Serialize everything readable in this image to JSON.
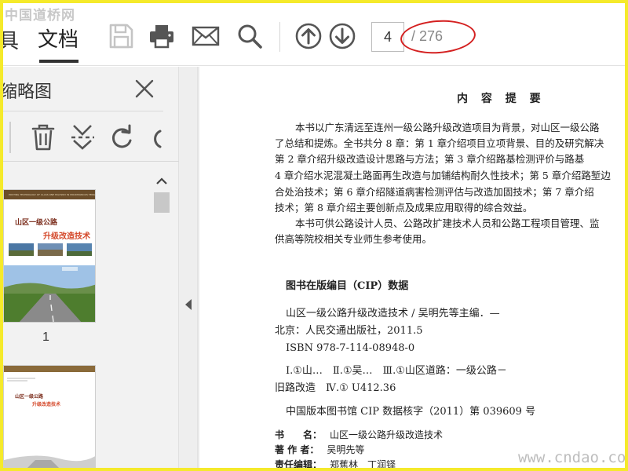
{
  "watermark": {
    "top": "中国道桥网",
    "bottom": "www.cndao.com"
  },
  "toolbar": {
    "menu_partial": "具",
    "menu_document": "文档",
    "icons": [
      "save-icon",
      "print-icon",
      "mail-icon",
      "search-icon",
      "page-up-icon",
      "page-down-icon"
    ],
    "current_page": "4",
    "total_pages": "/ 276"
  },
  "sidebar": {
    "title": "缩略图",
    "tools": [
      "delete-icon",
      "cut-icon",
      "rotate-icon",
      "rotate-partial-icon"
    ],
    "thumbnails": [
      {
        "label": "1",
        "header": "POSTING TECHNOLOGY OF CLASS ONE HIGHWAY IN MOUNTAINOUS TERRAIN",
        "title_line1": "山区一级公路",
        "title_line2": "升级改造技术"
      },
      {
        "label": "",
        "header": "",
        "title_line1": "山区一级公路",
        "title_line2": "升级改造技术"
      }
    ]
  },
  "document": {
    "heading": "内 容 提 要",
    "paragraphs": [
      "本书以广东清远至连州一级公路升级改造项目为背景，对山区一级公路",
      "了总结和提炼。全书共分 8 章：第 1 章介绍项目立项背景、目的及研究解决",
      "第 2 章介绍升级改造设计思路与方法；第 3 章介绍路基检测评价与路基",
      "4 章介绍水泥混凝土路面再生改造与加铺结构耐久性技术；第 5 章介绍路堑边",
      "合处治技术；第 6 章介绍隧道病害检测评估与改造加固技术；第 7 章介绍",
      "技术；第 8 章介绍主要创新点及成果应用取得的综合效益。",
      "本书可供公路设计人员、公路改扩建技术人员和公路工程项目管理、监",
      "供高等院校相关专业师生参考使用。"
    ],
    "cip_title": "图书在版编目（CIP）数据",
    "cip_lines": [
      "山区一级公路升级改造技术 / 吴明先等主编．—",
      "北京：人民交通出版社，2011.5",
      "ISBN 978-7-114-08948-0",
      "Ⅰ.①山…　Ⅱ.①吴…　Ⅲ.①山区道路：一级公路－",
      "旧路改造　Ⅳ.① U412.36",
      "中国版本图书馆 CIP 数据核字（2011）第 039609 号"
    ],
    "meta": [
      {
        "key": "书　　名：",
        "value": "山区一级公路升级改造技术"
      },
      {
        "key": "著 作 者：",
        "value": "吴明先等"
      },
      {
        "key": "责任编辑：",
        "value": "郑蕉林　丁润铎"
      }
    ]
  },
  "colors": {
    "frame": "#f5ea2b",
    "annotation": "#d42020",
    "accent": "#333333"
  }
}
